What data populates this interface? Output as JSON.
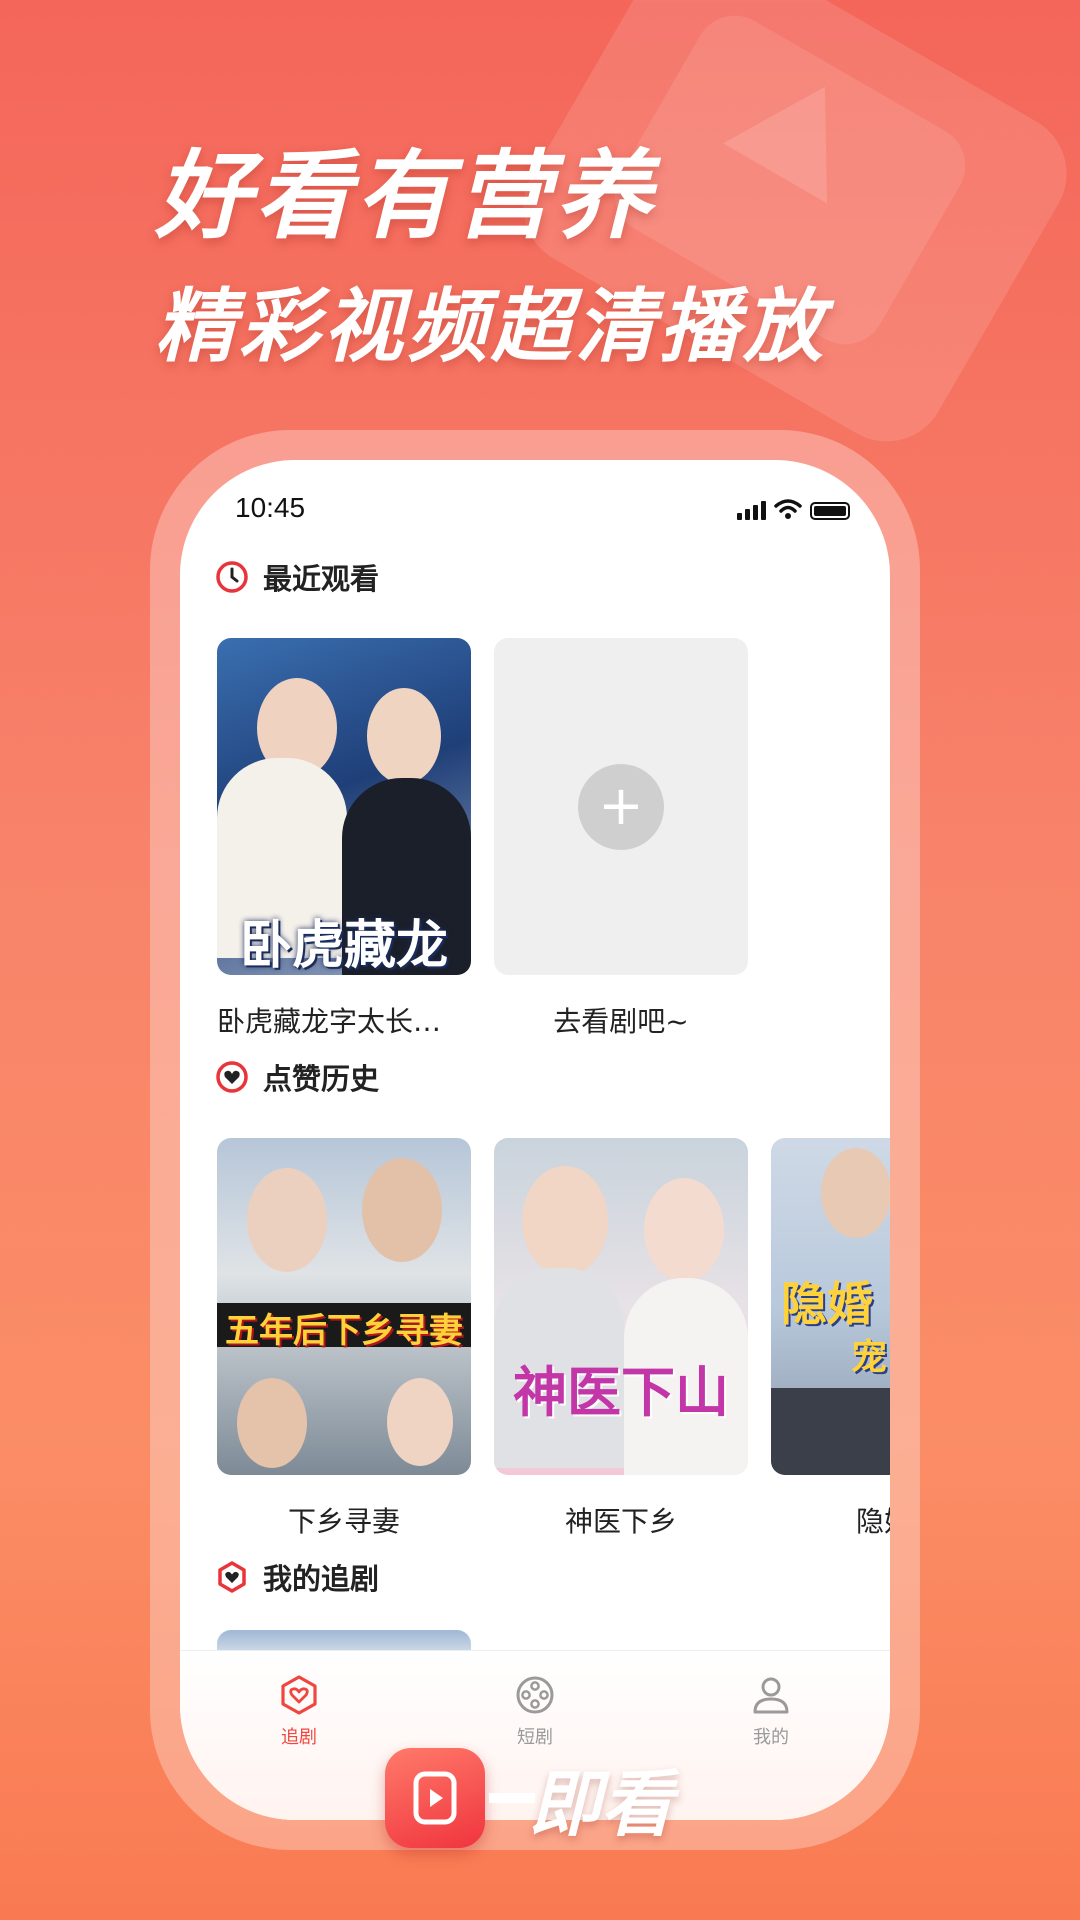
{
  "headline": {
    "line1": "好看有营养",
    "line2": "精彩视频超清播放"
  },
  "status_bar": {
    "time": "10:45"
  },
  "recent": {
    "title": "最近观看",
    "items": [
      {
        "caption": "卧虎藏龙字太长…",
        "poster_text": "卧虎藏龙"
      },
      {
        "caption": "去看剧吧~",
        "add_symbol": "+"
      }
    ]
  },
  "likes": {
    "title": "点赞历史",
    "items": [
      {
        "caption": "下乡寻妻",
        "poster_text": "五年后下乡寻妻"
      },
      {
        "caption": "神医下乡",
        "poster_text": "神医下山"
      },
      {
        "caption": "隐婚宠",
        "poster_text": "隐婚",
        "poster_sub": "宠"
      }
    ]
  },
  "following": {
    "title": "我的追剧"
  },
  "tabbar": {
    "tabs": [
      {
        "label": "追剧",
        "icon": "heart-hexagon-icon",
        "active": true
      },
      {
        "label": "短剧",
        "icon": "film-reel-icon",
        "active": false
      },
      {
        "label": "我的",
        "icon": "person-icon",
        "active": false
      }
    ],
    "active_color": "#f0463f",
    "inactive_color": "#9a9a9a"
  },
  "brand": {
    "name": "即看"
  }
}
